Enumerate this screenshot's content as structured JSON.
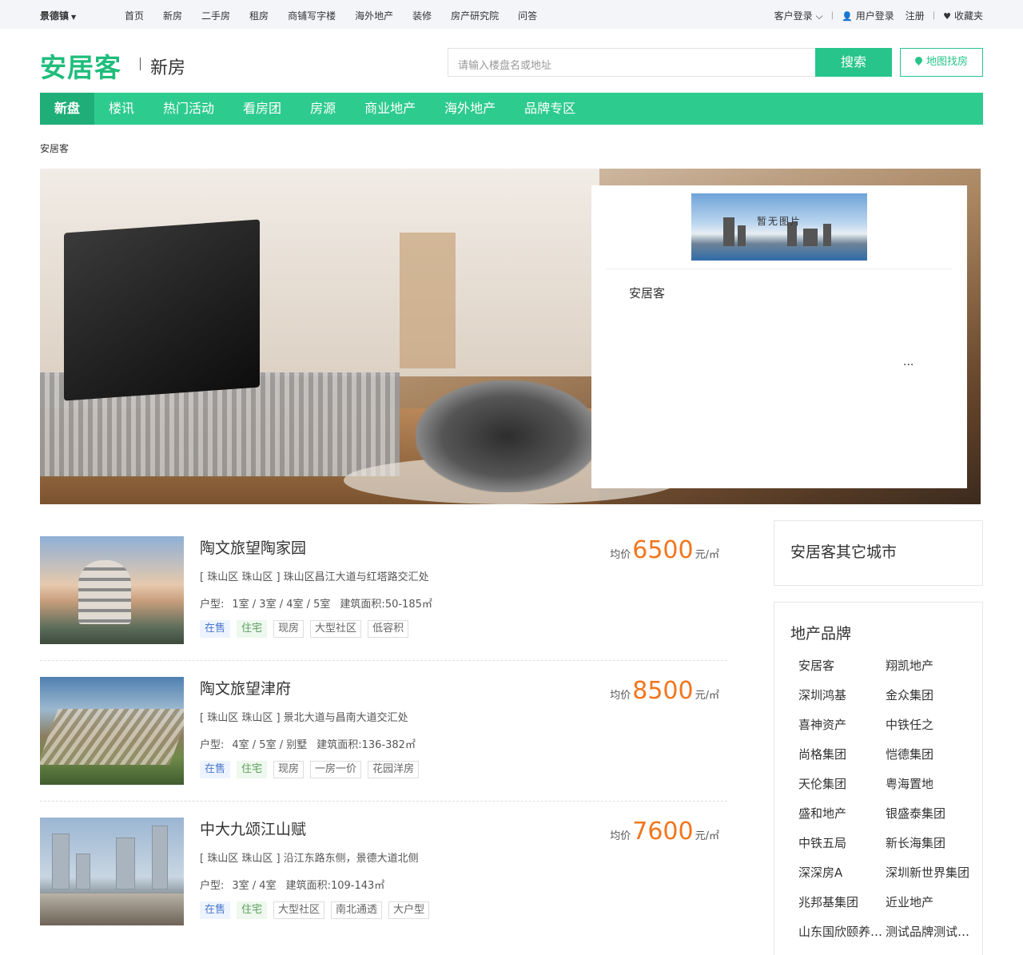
{
  "topbar": {
    "city": "景德镇",
    "nav": [
      "首页",
      "新房",
      "二手房",
      "租房",
      "商铺写字楼",
      "海外地产",
      "装修",
      "房产研究院",
      "问答"
    ],
    "customer_login": "客户登录",
    "user_login": "用户登录",
    "register": "注册",
    "favorites": "收藏夹"
  },
  "header": {
    "logo": "安居客",
    "channel": "新房",
    "search_placeholder": "请输入楼盘名或地址",
    "search_button": "搜索",
    "map_button": "地图找房"
  },
  "mainnav": [
    "新盘",
    "楼讯",
    "热门活动",
    "看房团",
    "房源",
    "商业地产",
    "海外地产",
    "品牌专区"
  ],
  "breadcrumb": "安居客",
  "banner": {
    "no_image_text": "暂无图片",
    "name": "安居客",
    "more": "..."
  },
  "listings": [
    {
      "title": "陶文旅望陶家园",
      "address": "[ 珠山区 珠山区 ] 珠山区昌江大道与红塔路交汇处",
      "layout_label": "户型:",
      "layout": "1室 / 3室 / 4室 / 5室",
      "area_label": "建筑面积:",
      "area": "50-185㎡",
      "tags": [
        "在售",
        "住宅",
        "现房",
        "大型社区",
        "低容积"
      ],
      "price_label": "均价",
      "price": "6500",
      "unit": "元/㎡"
    },
    {
      "title": "陶文旅望津府",
      "address": "[ 珠山区 珠山区 ] 景北大道与昌南大道交汇处",
      "layout_label": "户型:",
      "layout": "4室 / 5室 / 别墅",
      "area_label": "建筑面积:",
      "area": "136-382㎡",
      "tags": [
        "在售",
        "住宅",
        "现房",
        "一房一价",
        "花园洋房"
      ],
      "price_label": "均价",
      "price": "8500",
      "unit": "元/㎡"
    },
    {
      "title": "中大九颂江山赋",
      "address": "[ 珠山区 珠山区 ] 沿江东路东侧，景德大道北侧",
      "layout_label": "户型:",
      "layout": "3室 / 4室",
      "area_label": "建筑面积:",
      "area": "109-143㎡",
      "tags": [
        "在售",
        "住宅",
        "大型社区",
        "南北通透",
        "大户型"
      ],
      "price_label": "均价",
      "price": "7600",
      "unit": "元/㎡"
    }
  ],
  "sidebar": {
    "other_cities_title": "安居客其它城市",
    "brands_title": "地产品牌",
    "brands": [
      "安居客",
      "翔凯地产",
      "深圳鸿基",
      "金众集团",
      "喜神资产",
      "中铁任之",
      "尚格集团",
      "恺德集团",
      "天伦集团",
      "粤海置地",
      "盛和地产",
      "银盛泰集团",
      "中铁五局",
      "新长海集团",
      "深深房A",
      "深圳新世界集团",
      "兆邦基集团",
      "近业地产",
      "山东国欣颐养集团",
      "测试品牌测试品牌"
    ]
  },
  "colors": {
    "brand_green": "#1fbd7b",
    "nav_green": "#2ecb8e",
    "price_orange": "#f2761d"
  }
}
